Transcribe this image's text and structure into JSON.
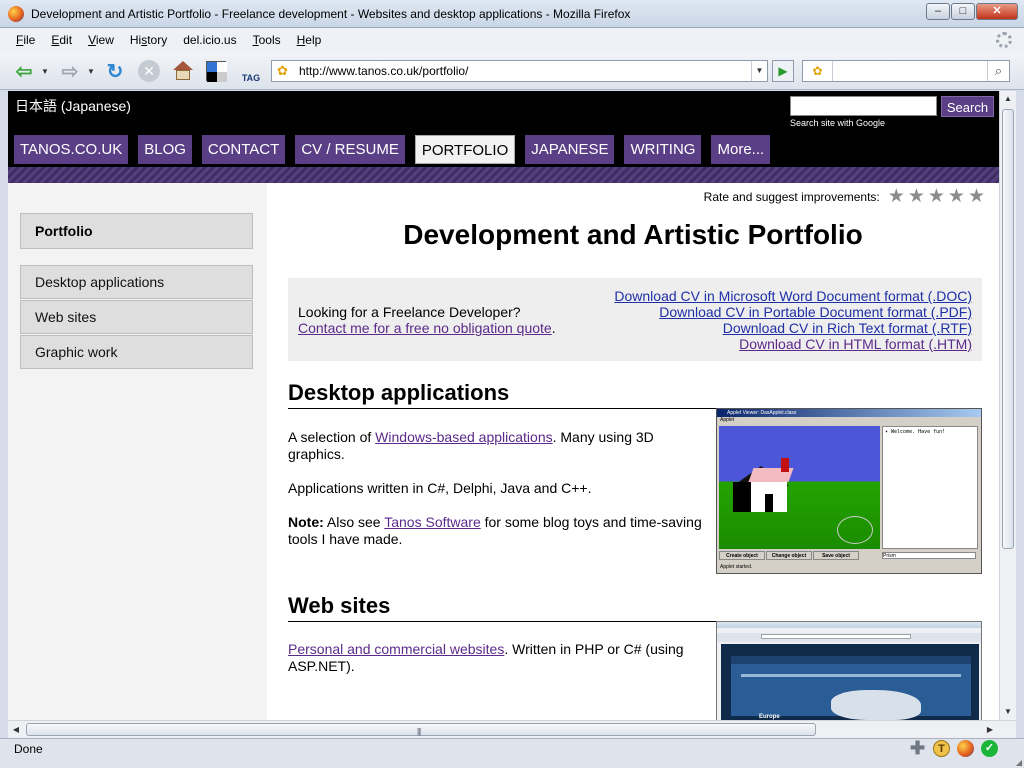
{
  "window": {
    "title": "Development and Artistic Portfolio - Freelance development - Websites and desktop applications - Mozilla Firefox",
    "controls": {
      "minimize": "–",
      "maximize": "□",
      "close": "✕"
    }
  },
  "menubar": {
    "items": [
      "File",
      "Edit",
      "View",
      "History",
      "del.icio.us",
      "Tools",
      "Help"
    ],
    "accel": [
      "F",
      "E",
      "V",
      "s",
      "",
      "T",
      "H"
    ]
  },
  "toolbar": {
    "url": "http://www.tanos.co.uk/portfolio/",
    "search_value": "",
    "tag_label": "TAG",
    "icons": {
      "back": "back-arrow-icon",
      "forward": "forward-arrow-icon",
      "reload": "reload-icon",
      "stop": "stop-icon",
      "home": "home-icon",
      "delicious": "delicious-icon",
      "tag": "tag-icon",
      "go": "go-arrow-icon",
      "search": "magnifier-icon"
    },
    "glyphs": {
      "back": "⇦",
      "forward": "⇨",
      "reload": "↻",
      "stop": "✕",
      "dropdown": "▼",
      "go": "▶",
      "paw": "✿",
      "magnifier": "⌕"
    },
    "colors": {
      "delicious": [
        "#3274d2",
        "#ffffff",
        "#000000",
        "#cccccc"
      ]
    }
  },
  "site": {
    "language_link": "日本語 (Japanese)",
    "search_button": "Search",
    "search_caption": "Search site with Google",
    "nav": [
      {
        "label": "TANOS.CO.UK",
        "active": false
      },
      {
        "label": "BLOG",
        "active": false
      },
      {
        "label": "CONTACT",
        "active": false
      },
      {
        "label": "CV / RESUME",
        "active": false
      },
      {
        "label": "PORTFOLIO",
        "active": true
      },
      {
        "label": "JAPANESE",
        "active": false
      },
      {
        "label": "WRITING",
        "active": false
      },
      {
        "label": "More...",
        "active": false
      }
    ],
    "colors": {
      "nav_bg": "#5b3f86",
      "link": "#5b2a8a",
      "download_link": "#1f2fa8"
    }
  },
  "sidebar": {
    "heading": "Portfolio",
    "items": [
      "Desktop applications",
      "Web sites",
      "Graphic work"
    ]
  },
  "main": {
    "rating_label": "Rate and suggest improvements:",
    "rating": {
      "value": 0,
      "max": 5,
      "star_glyph": "★"
    },
    "title": "Development and Artistic Portfolio",
    "cta": {
      "question": "Looking for a Freelance Developer?",
      "contact_link": "Contact me for a free no obligation quote",
      "contact_suffix": "."
    },
    "downloads": [
      "Download CV in Microsoft Word Document format (.DOC)",
      "Download CV in Portable Document format (.PDF)",
      "Download CV in Rich Text format (.RTF)",
      "Download CV in HTML format (.HTM)"
    ],
    "desktop": {
      "heading": "Desktop applications",
      "p1_prefix": "A selection of ",
      "p1_link": "Windows-based applications",
      "p1_suffix": ". Many using 3D graphics.",
      "p2": "Applications written in C#, Delphi, Java and C++.",
      "p3_bold": "Note:",
      "p3_prefix": " Also see ",
      "p3_link": "Tanos Software",
      "p3_suffix": " for some blog toys and time-saving tools I have made.",
      "applet": {
        "title": "Applet Viewer: DasApplet.class",
        "menu": "Applet",
        "log": "▾ Welcome. Have fun!",
        "buttons": [
          "Create object",
          "Change object",
          "Save object"
        ],
        "field": "Prism",
        "status": "Applet started."
      }
    },
    "websites": {
      "heading": "Web sites",
      "p1_link": "Personal and commercial websites",
      "p1_suffix": ". Written in PHP or C# (using ASP.NET).",
      "thumb_label": "Europe"
    }
  },
  "status": {
    "text": "Done",
    "icons": [
      "plus-icon",
      "t-icon",
      "firefox-icon",
      "check-icon"
    ],
    "glyphs": {
      "plus": "✚",
      "t": "T",
      "check": "✓"
    }
  },
  "scrollbars": {
    "arrows": {
      "up": "▲",
      "down": "▼",
      "left": "◀",
      "right": "▶"
    },
    "grip": "|||"
  }
}
